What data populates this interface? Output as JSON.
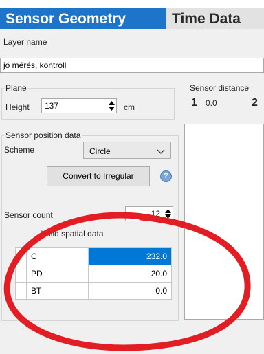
{
  "tabs": [
    {
      "label": "Sensor Geometry",
      "active": true
    },
    {
      "label": "Time Data",
      "active": false
    }
  ],
  "layer": {
    "label": "Layer name",
    "value": "jó mérés, kontroll"
  },
  "plane": {
    "group_label": "Plane",
    "height_label": "Height",
    "height_value": "137",
    "unit": "cm"
  },
  "sensor_distance": {
    "label": "Sensor distance",
    "idx1": "1",
    "value1": "0.0",
    "idx2": "2"
  },
  "sensor_position": {
    "group_label": "Sensor position data",
    "scheme_label": "Scheme",
    "scheme_value": "Circle",
    "convert_button": "Convert to Irregular",
    "sensor_count_label": "Sensor count",
    "sensor_count_value": "12"
  },
  "spatial": {
    "label": "Valid spatial data",
    "rows": [
      {
        "name": "C",
        "value": "232.0",
        "selected": true
      },
      {
        "name": "PD",
        "value": "20.0",
        "selected": false
      },
      {
        "name": "BT",
        "value": "0.0",
        "selected": false
      }
    ]
  },
  "colors": {
    "tab_active": "#1d74c8",
    "selection": "#0078d7",
    "annotation": "#e21d24"
  },
  "icons": {
    "help": "help-icon",
    "spinner": "spin-arrows-icon",
    "dropdown": "chevron-down-icon",
    "row_pointer": "row-pointer-icon"
  }
}
